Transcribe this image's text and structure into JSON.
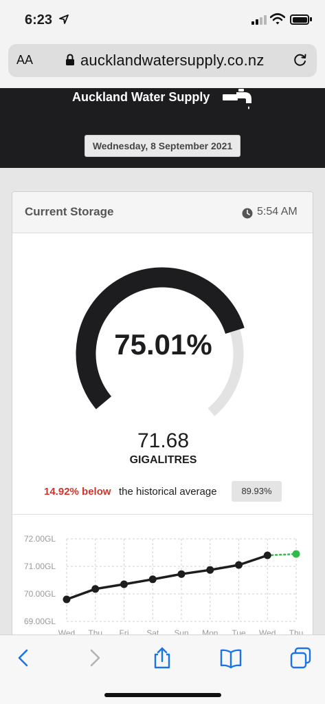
{
  "status_bar": {
    "time": "6:23"
  },
  "browser": {
    "text_size_label": "AA",
    "url": "aucklandwatersupply.co.nz"
  },
  "site": {
    "title": "Auckland Water Supply",
    "date": "Wednesday, 8 September 2021"
  },
  "card": {
    "title": "Current Storage",
    "updated_time": "5:54 AM",
    "gauge": {
      "percent_label": "75.01%",
      "fill_fraction": 0.7501
    },
    "volume": {
      "value": "71.68",
      "unit": "GIGALITRES"
    },
    "comparison": {
      "difference": "14.92% below",
      "text": "the historical average",
      "average": "89.93%"
    }
  },
  "colors": {
    "header_bg": "#1d1d1f",
    "gauge_fill": "#1d1d1f",
    "gauge_track": "#e3e3e3",
    "below_text": "#d0342c",
    "forecast_point": "#2fba4a"
  },
  "chart_data": {
    "type": "line",
    "categories": [
      "Wed",
      "Thu",
      "Fri",
      "Sat",
      "Sun",
      "Mon",
      "Tue",
      "Wed",
      "Thu"
    ],
    "y_tick_labels": [
      "72.00GL",
      "71.00GL",
      "70.00GL",
      "69.00GL"
    ],
    "ylim": [
      69,
      72
    ],
    "grid": true,
    "series": [
      {
        "values": [
          69.8,
          70.18,
          70.35,
          70.53,
          70.72,
          70.87,
          71.05,
          71.4
        ]
      }
    ],
    "forecast": {
      "from_index": 7,
      "to_index": 8,
      "values": [
        71.4,
        71.45
      ]
    }
  }
}
